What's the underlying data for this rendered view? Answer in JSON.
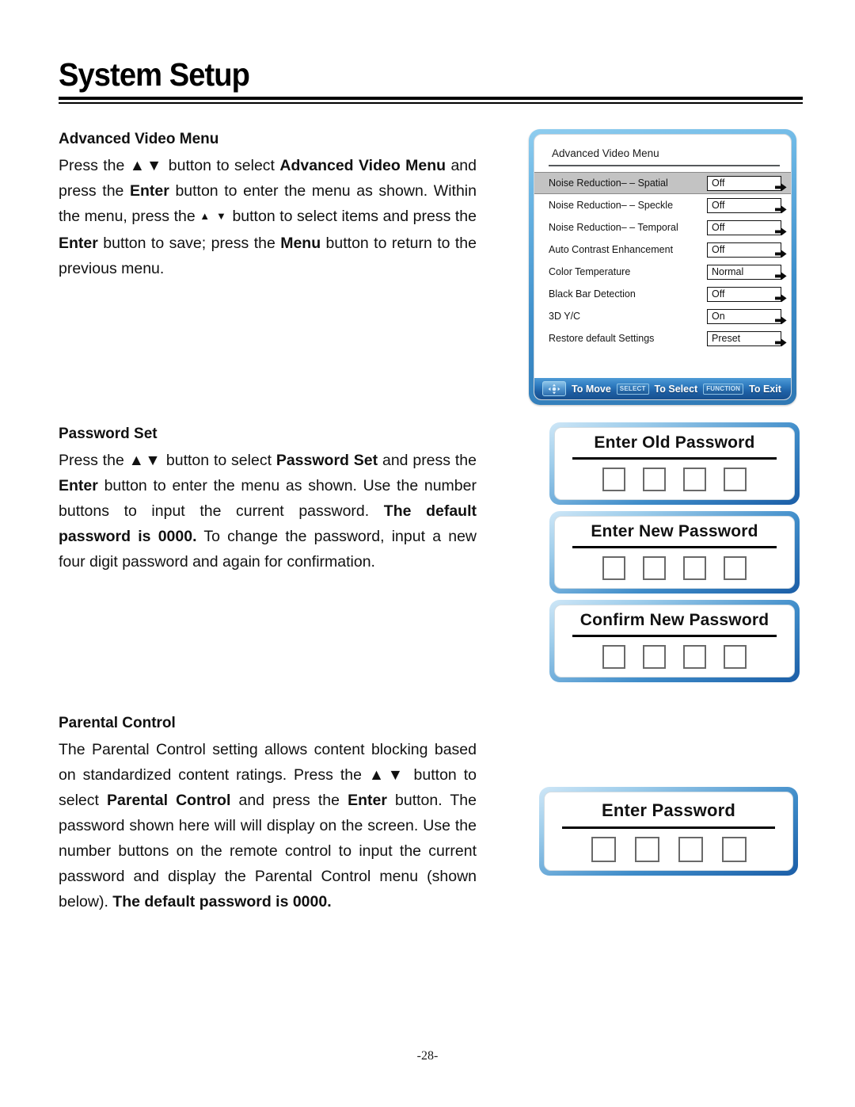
{
  "page": {
    "title": "System Setup",
    "page_number": "-28-"
  },
  "sections": [
    {
      "id": "advanced_video_menu",
      "heading": "Advanced Video Menu",
      "paragraph_html": "Press the <span class=\"arrows\">▲▼</span> button to select <b>Advanced Video Menu</b> and press the <b>Enter</b> button to enter the menu as shown. Within the menu, press the <span class=\"arrows-sm\">▲ ▼</span> button to select items and press the <b>Enter</b> button to save; press the <b>Menu</b> button to return to the previous menu."
    },
    {
      "id": "password_set",
      "heading": "Password Set",
      "paragraph_html": "Press the <span class=\"arrows\">▲▼</span> button to select <b>Password Set</b> and press the <b>Enter</b> button to enter the menu as shown. Use the number buttons to input the current password. <b>The default password is 0000.</b> To change the password, input a new four digit password and again for confirmation."
    },
    {
      "id": "parental_control",
      "heading": "Parental Control",
      "paragraph_html": "The Parental Control setting allows content blocking based on standardized content ratings. Press the <span class=\"arrows\">▲▼</span> button to select <b>Parental Control</b> and press the <b>Enter</b> button. The password shown here will will display on the screen. Use the number buttons on the remote control to input the current password and display the Parental Control menu (shown below). <b>The default password is 0000.</b>"
    }
  ],
  "osd_menu": {
    "title": "Advanced Video Menu",
    "selected_index": 0,
    "rows": [
      {
        "label": "Noise Reduction– – Spatial",
        "value": "Off"
      },
      {
        "label": "Noise Reduction– – Speckle",
        "value": "Off"
      },
      {
        "label": "Noise Reduction– – Temporal",
        "value": "Off"
      },
      {
        "label": "Auto Contrast Enhancement",
        "value": "Off"
      },
      {
        "label": "Color Temperature",
        "value": "Normal"
      },
      {
        "label": "Black Bar Detection",
        "value": "Off"
      },
      {
        "label": "3D Y/C",
        "value": "On"
      },
      {
        "label": "Restore default Settings",
        "value": "Preset"
      }
    ],
    "status_bar": {
      "move_label": "To Move",
      "select_key": "SELECT",
      "select_label": "To Select",
      "function_key": "FUNCTION",
      "exit_label": "To Exit"
    },
    "colors": {
      "frame_light": "#6fb9e6",
      "frame_dark": "#2f78b4",
      "selected_row": "#c3c3c3",
      "status_bar": "#1e5fa4"
    }
  },
  "password_dialogs": [
    {
      "id": "enter_old_password",
      "title": "Enter Old Password",
      "digits": 4
    },
    {
      "id": "enter_new_password",
      "title": "Enter New Password",
      "digits": 4
    },
    {
      "id": "confirm_new_password",
      "title": "Confirm New Password",
      "digits": 4
    },
    {
      "id": "enter_password",
      "title": "Enter Password",
      "digits": 4
    }
  ]
}
